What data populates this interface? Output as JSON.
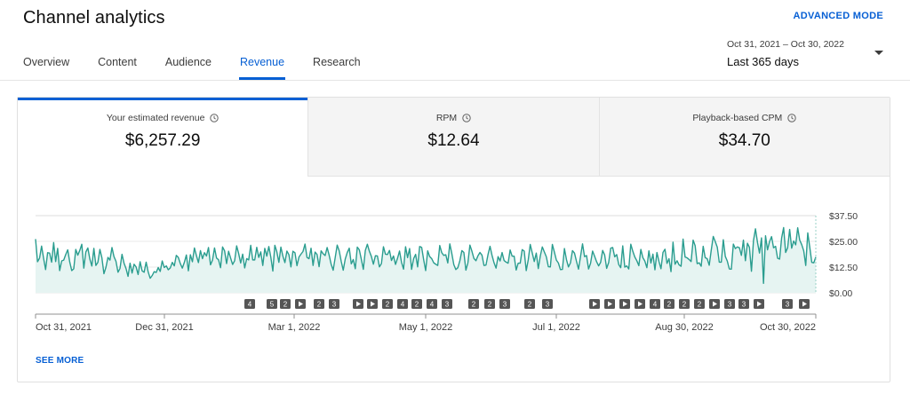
{
  "header": {
    "title": "Channel analytics",
    "advanced_mode": "ADVANCED MODE"
  },
  "tabs": [
    {
      "label": "Overview",
      "active": false
    },
    {
      "label": "Content",
      "active": false
    },
    {
      "label": "Audience",
      "active": false
    },
    {
      "label": "Revenue",
      "active": true
    },
    {
      "label": "Research",
      "active": false
    }
  ],
  "date_range": {
    "range": "Oct 31, 2021 – Oct 30, 2022",
    "label": "Last 365 days"
  },
  "metrics": [
    {
      "label": "Your estimated revenue",
      "value": "$6,257.29",
      "icon": "clock-icon",
      "active": true
    },
    {
      "label": "RPM",
      "value": "$12.64",
      "icon": "clock-icon",
      "active": false
    },
    {
      "label": "Playback-based CPM",
      "value": "$34.70",
      "icon": "clock-icon",
      "active": false
    }
  ],
  "see_more": "SEE MORE",
  "colors": {
    "accent": "#065fd4",
    "line": "#2a9d8f",
    "fill": "#e6f4f2"
  },
  "chart_data": {
    "type": "area",
    "series": [
      {
        "values": [
          26.1,
          15.1,
          16.9,
          22.7,
          16.8,
          11.3,
          19.5,
          19.3,
          14.9,
          24.4,
          15.2,
          21.6,
          10.8,
          15.5,
          15.9,
          18.6,
          20.9,
          15,
          10.8,
          11.7,
          21.1,
          18.3,
          20.6,
          23.6,
          12,
          19.8,
          21.8,
          16.4,
          13,
          21.6,
          13.3,
          14.8,
          21.1,
          17,
          9.3,
          12.4,
          17.2,
          15.9,
          22,
          17.6,
          15.3,
          10,
          11.9,
          18.7,
          14.4,
          11.8,
          8,
          14.4,
          9.6,
          13.9,
          12.6,
          8.9,
          15.1,
          10.7,
          10,
          14.9,
          10.2,
          7.1,
          8.4,
          10.3,
          9.9,
          12.3,
          10.4,
          15.5,
          12.3,
          13.1,
          11.2,
          12.1,
          14.8,
          13.1,
          18.2,
          17.2,
          14.2,
          12,
          14.8,
          18.4,
          10.7,
          18.5,
          15.1,
          21.8,
          18.1,
          14.7,
          20.5,
          16.6,
          19.5,
          17.9,
          22,
          13.6,
          15.9,
          21.8,
          16.9,
          16.1,
          12.2,
          22.3,
          20.4,
          14.2,
          20.2,
          16.9,
          13.8,
          15.6,
          22.8,
          19.1,
          14.5,
          18.8,
          12.1,
          16.6,
          16,
          23.1,
          16,
          16,
          22.1,
          17.2,
          19.9,
          13.3,
          21.6,
          17.8,
          22.5,
          17.3,
          10.6,
          23.1,
          19.9,
          14.8,
          22.2,
          17.8,
          14.7,
          20.3,
          18.5,
          12.6,
          20.2,
          19.5,
          13.2,
          17.4,
          18.8,
          20.1,
          23.7,
          17.2,
          16.6,
          21.7,
          13.3,
          19.8,
          18.6,
          12.7,
          20.4,
          19,
          18.1,
          22,
          18.3,
          13.9,
          11,
          17.1,
          23.2,
          20.4,
          15.3,
          11,
          16.4,
          19.6,
          21.7,
          14.1,
          16.2,
          11.7,
          22.2,
          20.9,
          16.3,
          11.4,
          20.6,
          23.6,
          20.2,
          17.7,
          13.9,
          18,
          17.9,
          12.6,
          14.2,
          22.4,
          18.8,
          18.6,
          20.6,
          15.7,
          17.9,
          13.8,
          16.8,
          20.3,
          14.8,
          11.5,
          22.4,
          17.1,
          21.5,
          11.4,
          16.6,
          18.7,
          12.6,
          22.5,
          22.1,
          16.1,
          10.8,
          20.4,
          17.6,
          16.6,
          14.6,
          13.9,
          13.3,
          23,
          19.5,
          18.2,
          18.5,
          14.5,
          23.8,
          19.1,
          13.7,
          11.3,
          12.2,
          15.6,
          20.5,
          19.6,
          11,
          14.6,
          23.2,
          20.2,
          16.7,
          15.6,
          18,
          19.6,
          18.3,
          13.3,
          13.5,
          18.6,
          22.6,
          18.2,
          14.6,
          12,
          17.6,
          15.5,
          19.6,
          15.7,
          14.9,
          14.4,
          20.8,
          17.8,
          17.8,
          11.1,
          14.4,
          14.4,
          21,
          20.3,
          10.8,
          16,
          23.5,
          19.4,
          15.2,
          19.3,
          11.8,
          17.9,
          22.3,
          19.9,
          17.5,
          12.7,
          12.6,
          23.5,
          19.8,
          15.9,
          14.5,
          11.3,
          11.4,
          21.5,
          16.2,
          12.6,
          14.6,
          20.5,
          19.3,
          15.3,
          11.5,
          17.6,
          23.8,
          17.6,
          18.1,
          11.6,
          14.4,
          20.3,
          17.8,
          15.1,
          13.1,
          14.8,
          20.6,
          18.4,
          11.9,
          14.7,
          21.7,
          22,
          17.5,
          18.6,
          13.8,
          12.2,
          22.8,
          12.5,
          13.1,
          11.6,
          23.6,
          20.2,
          17.4,
          15.6,
          13.2,
          21.1,
          17.1,
          15.4,
          12.2,
          20.4,
          14.5,
          18.8,
          11.2,
          19.6,
          15.3,
          11.7,
          19.6,
          21.2,
          14.3,
          16.6,
          10.3,
          24.6,
          13.9,
          15.6,
          13.6,
          12.9,
          26.1,
          17.4,
          17,
          16.2,
          15.2,
          25.6,
          22.9,
          14.2,
          14.6,
          12.9,
          22.6,
          17.1,
          16.6,
          13.4,
          20.7,
          27.4,
          24.9,
          22.2,
          14.9,
          14.9,
          25.8,
          17.7,
          15.4,
          11.6,
          11.5,
          23.7,
          21.5,
          22.3,
          21.9,
          18.2,
          25.6,
          15.6,
          24.1,
          22.1,
          10.5,
          25.3,
          31.1,
          24.5,
          19.3,
          26.7,
          4.6,
          27.7,
          20.9,
          24.9,
          27.3,
          21.9,
          22.6,
          16.8,
          16.4,
          26.6,
          31.7,
          19.6,
          21.9,
          30.8,
          21.7,
          25.2,
          23.3,
          31.6,
          25.6,
          23.4,
          20.4,
          13.3,
          29.1,
          22.2,
          14.8,
          14.6,
          17.4
        ]
      }
    ],
    "x_tick_labels": [
      "Oct 31, 2021",
      "Dec 31, 2021",
      "Mar 1, 2022",
      "May 1, 2022",
      "Jul 1, 2022",
      "Aug 30, 2022",
      "Oct 30, 2022"
    ],
    "y_tick_labels": [
      "$37.50",
      "$25.00",
      "$12.50",
      "$0.00"
    ],
    "y_ticks": [
      37.5,
      25,
      12.5,
      0
    ],
    "ylim": [
      0,
      37.5
    ],
    "grid": true,
    "markers": [
      "4",
      "5",
      "2",
      "▶",
      "2",
      "3",
      "▶",
      "▶",
      "2",
      "4",
      "2",
      "4",
      "3",
      "2",
      "2",
      "3",
      "2",
      "3",
      "▶",
      "▶",
      "▶",
      "▶",
      "4",
      "2",
      "2",
      "2",
      "▶",
      "3",
      "3",
      "▶"
    ]
  }
}
